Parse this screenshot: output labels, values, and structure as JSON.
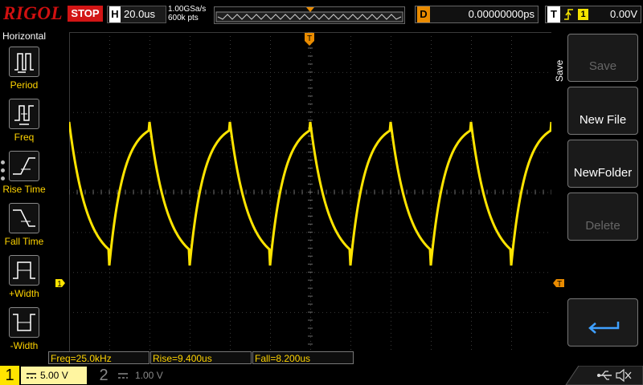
{
  "top": {
    "brand": "RIGOL",
    "run_state": "STOP",
    "timebase_label": "H",
    "timebase": "20.0us",
    "sample_rate": "1.00GSa/s",
    "memory_depth": "600k pts",
    "delay_label": "D",
    "delay": "0.00000000ps",
    "trigger_label": "T",
    "trigger_source": "1",
    "trigger_level": "0.00V"
  },
  "left_menu": {
    "title": "Horizontal",
    "items": [
      {
        "label": "Period",
        "icon": "period-icon"
      },
      {
        "label": "Freq",
        "icon": "freq-icon"
      },
      {
        "label": "Rise Time",
        "icon": "rise-time-icon"
      },
      {
        "label": "Fall Time",
        "icon": "fall-time-icon"
      },
      {
        "label": "+Width",
        "icon": "pos-width-icon"
      },
      {
        "label": "-Width",
        "icon": "neg-width-icon"
      }
    ]
  },
  "right_menu": {
    "title": "Save",
    "buttons": [
      {
        "label": "Save",
        "enabled": false
      },
      {
        "label": "New File",
        "enabled": true
      },
      {
        "label": "NewFolder",
        "enabled": true
      },
      {
        "label": "Delete",
        "enabled": false
      },
      {
        "label": "",
        "enabled": true,
        "icon": "return-arrow-icon"
      }
    ]
  },
  "markers": {
    "channel1_marker": "1",
    "trigger_top_marker": "T",
    "trigger_level_marker": "T"
  },
  "measurements": {
    "freq": "Freq=25.0kHz",
    "rise": "Rise=9.400us",
    "fall": "Fall=8.200us"
  },
  "channels": {
    "ch1_num": "1",
    "ch1_scale": "5.00 V",
    "ch2_num": "2",
    "ch2_scale": "1.00 V"
  },
  "colors": {
    "ch1": "#ffe400",
    "trigger": "#e98b00",
    "stop": "#d21515",
    "brand": "#d01010"
  },
  "trace": {
    "period_us": 40,
    "cycles_visible": 6,
    "shape": "RC charge/discharge"
  }
}
